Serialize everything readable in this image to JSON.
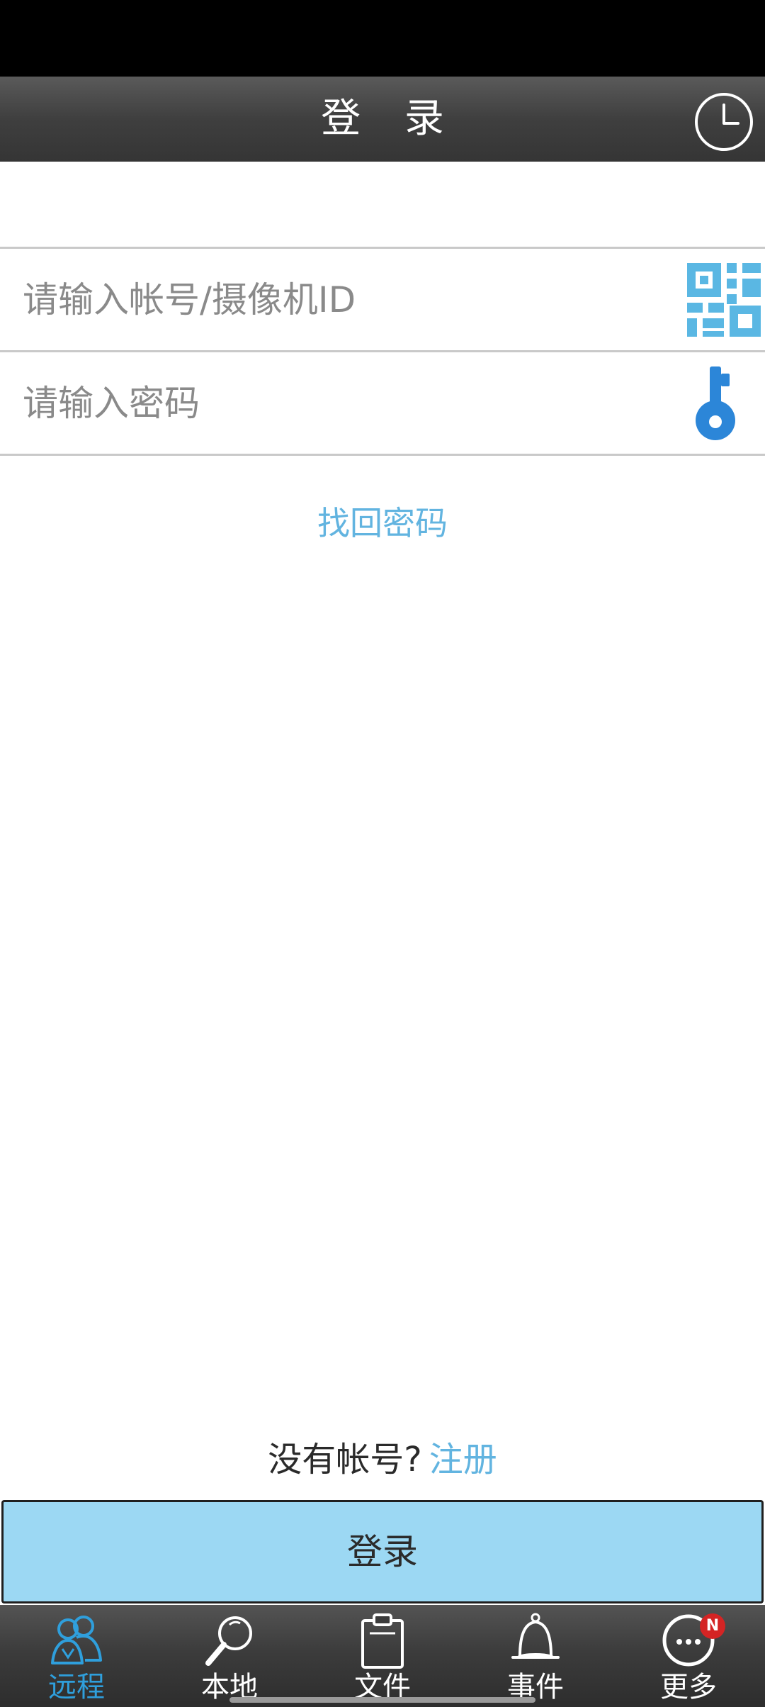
{
  "header": {
    "title": "登 录",
    "history_icon": "clock-icon"
  },
  "form": {
    "account_placeholder": "请输入帐号/摄像机ID",
    "account_value": "",
    "scan_icon": "qr-code-icon",
    "password_placeholder": "请输入密码",
    "password_value": "",
    "key_icon": "key-icon",
    "forgot_password": "找回密码"
  },
  "register": {
    "prompt": "没有帐号?",
    "link": "注册"
  },
  "login_button": "登录",
  "tabbar": {
    "items": [
      {
        "label": "远程",
        "icon": "users-icon",
        "active": true
      },
      {
        "label": "本地",
        "icon": "magnifier-icon",
        "active": false
      },
      {
        "label": "文件",
        "icon": "clipboard-icon",
        "active": false
      },
      {
        "label": "事件",
        "icon": "bell-icon",
        "active": false
      },
      {
        "label": "更多",
        "icon": "more-icon",
        "active": false,
        "badge": "N"
      }
    ]
  },
  "colors": {
    "accent": "#2f9fdc",
    "link": "#62b4e0",
    "button_bg": "#9cd8f3",
    "badge": "#d42424"
  }
}
